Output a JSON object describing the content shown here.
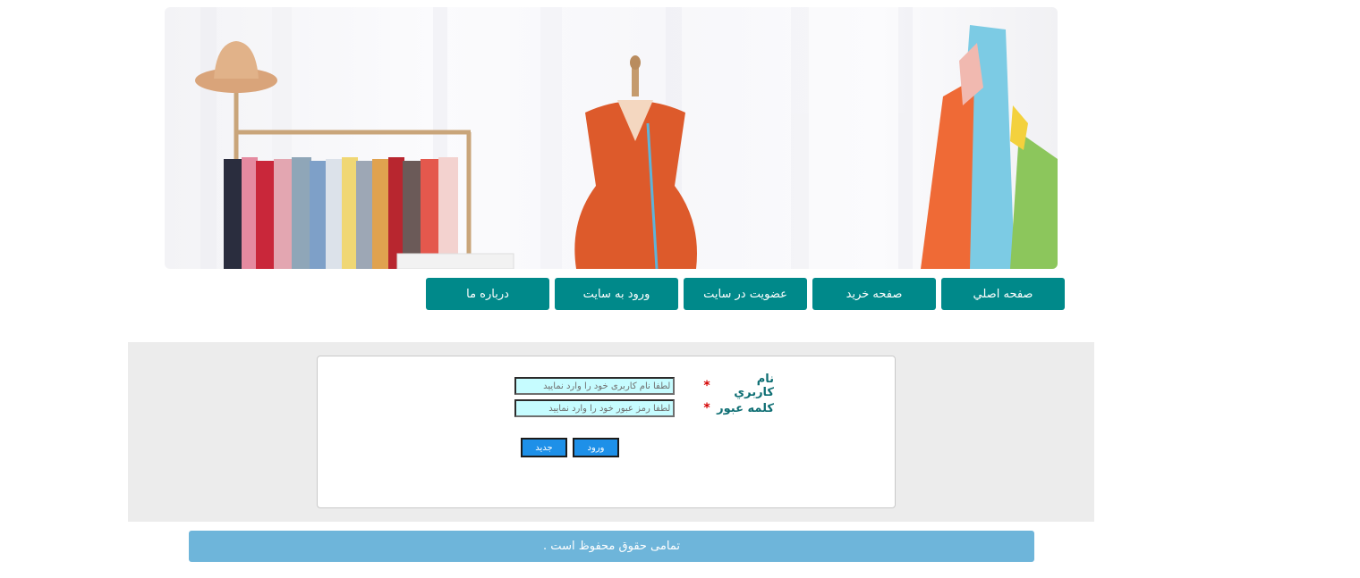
{
  "banner": {
    "alt": "clothing shop banner"
  },
  "nav": {
    "items": [
      {
        "label": "صفحه اصلي"
      },
      {
        "label": "صفحه خريد"
      },
      {
        "label": "عضويت در سايت"
      },
      {
        "label": "ورود به سايت"
      },
      {
        "label": "درباره ما"
      }
    ]
  },
  "login": {
    "username_label": "نام كاربري",
    "username_placeholder": "لطفا نام کاربری خود را وارد نمایید",
    "password_label": "كلمه عبور",
    "password_placeholder": "لطفا رمز عبور خود را وارد نمایید",
    "required_mark": "*",
    "login_button": "ورود",
    "new_button": "جديد"
  },
  "footer": {
    "text": "تمامی حقوق محفوظ است ."
  },
  "colors": {
    "nav": "#00898a",
    "label": "#0f6f74",
    "input_bg": "#c6fcff",
    "button": "#1e90e8",
    "footer": "#6eb5da",
    "panel": "#ececec"
  }
}
